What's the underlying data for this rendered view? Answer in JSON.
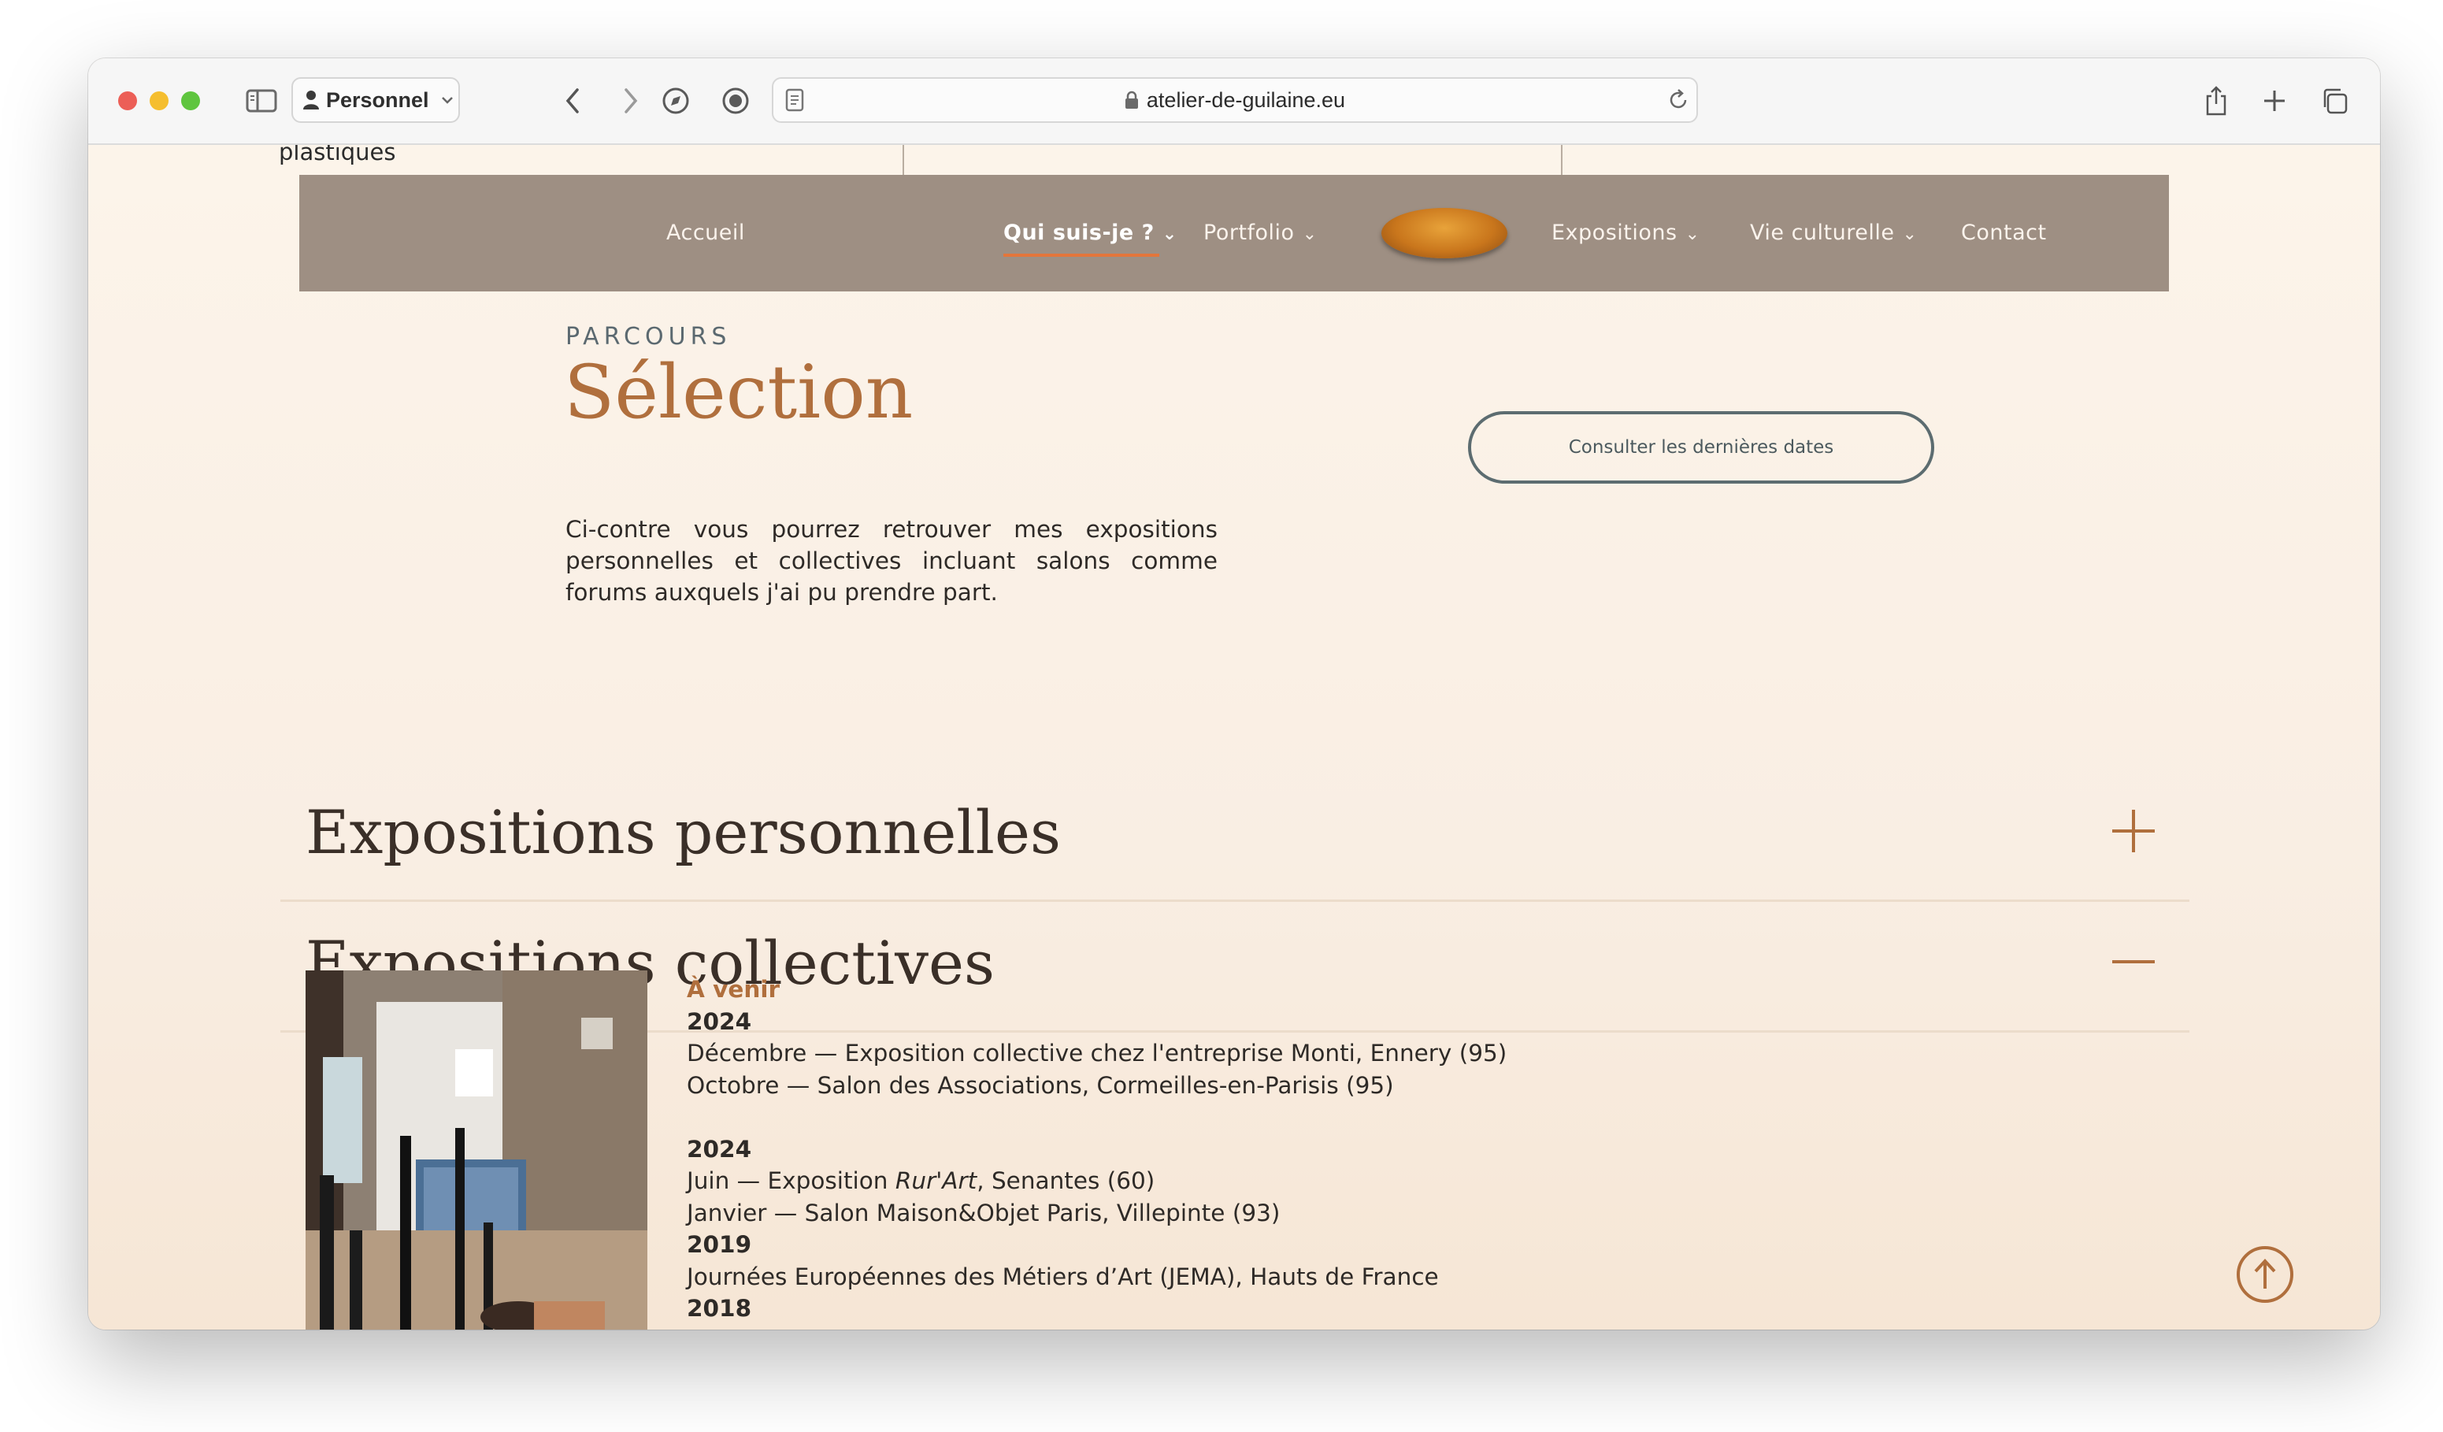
{
  "browser": {
    "profile_label": "Personnel",
    "url": "atelier-de-guilaine.eu",
    "traffic_lights": {
      "close": "#ec5f57",
      "minimize": "#f5be2f",
      "zoom": "#5fc53f"
    }
  },
  "page": {
    "partial_text_top": "plastiques",
    "nav": {
      "items": [
        {
          "label": "Accueil"
        },
        {
          "label": "Qui suis-je ?",
          "active": true,
          "has_dropdown": true
        },
        {
          "label": "Portfolio",
          "has_dropdown": true
        },
        {
          "label": "Expositions",
          "has_dropdown": true
        },
        {
          "label": "Vie culturelle",
          "has_dropdown": true
        },
        {
          "label": "Contact"
        }
      ],
      "logo_alt": "Atelier Guilaine",
      "accent_color": "#e3763b",
      "background_color": "#9e8f83"
    },
    "section": {
      "eyebrow": "PARCOURS",
      "title": "Sélection",
      "intro": "Ci-contre vous pourrez retrouver mes expositions personnelles et collectives incluant salons comme forums auxquels j'ai pu prendre part.",
      "cta_label": "Consulter les dernières dates"
    },
    "accordions": [
      {
        "title": "Expositions personnelles",
        "state": "collapsed",
        "toggle_icon": "plus-icon"
      },
      {
        "title": "Expositions collectives",
        "state": "expanded",
        "toggle_icon": "minus-icon"
      }
    ],
    "collective_list": {
      "upcoming_heading": "À venir",
      "year_2024_a": "2024",
      "entry_dec": "Décembre — Exposition collective chez l'entreprise Monti, Ennery (95)",
      "entry_oct": "Octobre — Salon des Associations, Cormeilles-en-Parisis (95)",
      "year_2024_b": "2024",
      "entry_jun_prefix": "Juin — Exposition ",
      "entry_jun_italic": "Rur'Art",
      "entry_jun_suffix": ", Senantes (60)",
      "entry_jan": "Janvier — Salon Maison&Objet Paris, Villepinte (93)",
      "year_2019": "2019",
      "entry_jema": "Journées Européennes des Métiers d’Art (JEMA), Hauts de France",
      "year_cut": "2018"
    },
    "brand_color": "#b06f3d"
  }
}
